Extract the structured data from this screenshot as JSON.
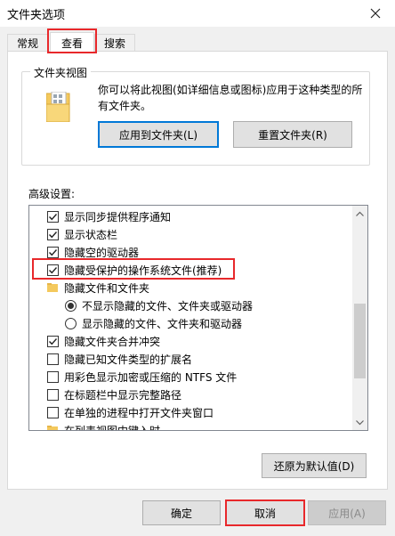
{
  "window": {
    "title": "文件夹选项"
  },
  "tabs": [
    {
      "label": "常规"
    },
    {
      "label": "查看"
    },
    {
      "label": "搜索"
    }
  ],
  "folder_views": {
    "title": "文件夹视图",
    "description": "你可以将此视图(如详细信息或图标)应用于这种类型的所有文件夹。",
    "apply_button": "应用到文件夹(L)",
    "reset_button": "重置文件夹(R)"
  },
  "advanced": {
    "label": "高级设置:",
    "items": [
      {
        "type": "checkbox",
        "checked": true,
        "label": "显示同步提供程序通知"
      },
      {
        "type": "checkbox",
        "checked": true,
        "label": "显示状态栏"
      },
      {
        "type": "checkbox",
        "checked": true,
        "label": "隐藏空的驱动器"
      },
      {
        "type": "checkbox",
        "checked": true,
        "label": "隐藏受保护的操作系统文件(推荐)"
      },
      {
        "type": "folder",
        "label": "隐藏文件和文件夹"
      },
      {
        "type": "radio",
        "checked": true,
        "label": "不显示隐藏的文件、文件夹或驱动器"
      },
      {
        "type": "radio",
        "checked": false,
        "label": "显示隐藏的文件、文件夹和驱动器"
      },
      {
        "type": "checkbox",
        "checked": true,
        "label": "隐藏文件夹合并冲突"
      },
      {
        "type": "checkbox",
        "checked": false,
        "label": "隐藏已知文件类型的扩展名"
      },
      {
        "type": "checkbox",
        "checked": false,
        "label": "用彩色显示加密或压缩的 NTFS 文件"
      },
      {
        "type": "checkbox",
        "checked": false,
        "label": "在标题栏中显示完整路径"
      },
      {
        "type": "checkbox",
        "checked": false,
        "label": "在单独的进程中打开文件夹窗口"
      },
      {
        "type": "folder",
        "label": "在列表视图中键入时"
      }
    ]
  },
  "buttons": {
    "restore_defaults": "还原为默认值(D)",
    "ok": "确定",
    "cancel": "取消",
    "apply": "应用(A)"
  },
  "colors": {
    "highlight": "#e8282b",
    "focus": "#0078d7"
  }
}
